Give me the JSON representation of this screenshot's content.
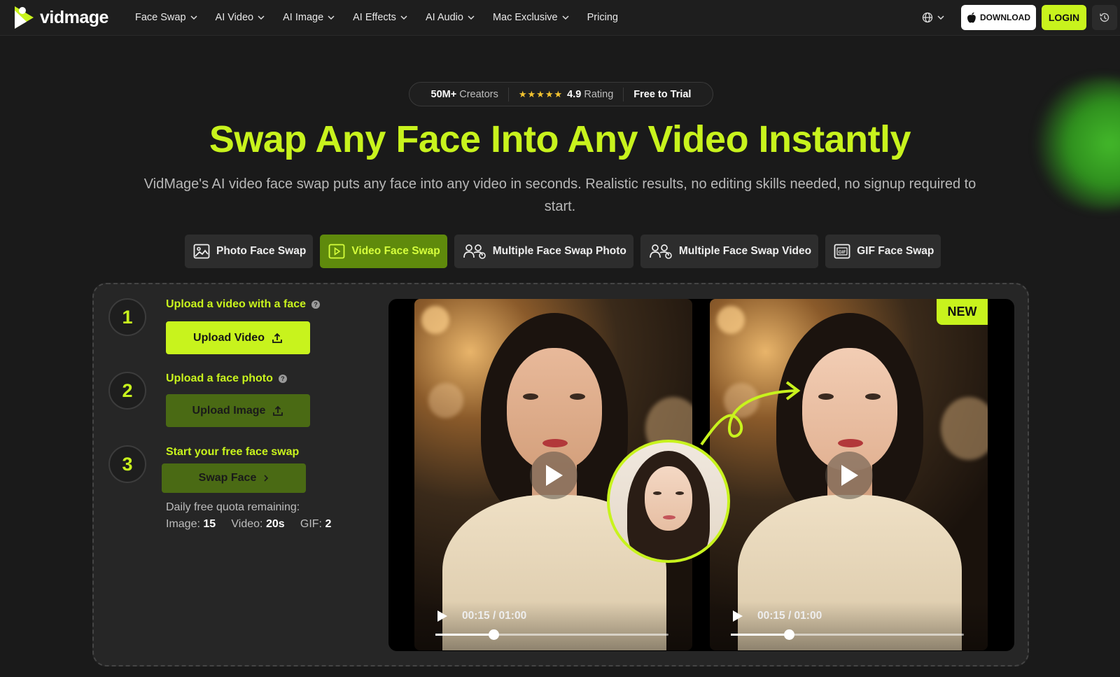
{
  "brand": {
    "name": "vidmage"
  },
  "nav": {
    "items": [
      {
        "label": "Face Swap",
        "dropdown": true
      },
      {
        "label": "AI Video",
        "dropdown": true
      },
      {
        "label": "AI Image",
        "dropdown": true
      },
      {
        "label": "AI Effects",
        "dropdown": true
      },
      {
        "label": "AI Audio",
        "dropdown": true
      },
      {
        "label": "Mac Exclusive",
        "dropdown": true
      },
      {
        "label": "Pricing",
        "dropdown": false
      }
    ],
    "download_label": "DOWNLOAD",
    "login_label": "LOGIN"
  },
  "stats": {
    "creators_value": "50M+",
    "creators_label": "Creators",
    "stars": "★★★★★",
    "rating_value": "4.9",
    "rating_label": "Rating",
    "trial_label": "Free to Trial"
  },
  "hero": {
    "title": "Swap Any Face Into Any Video Instantly",
    "subtitle": "VidMage's AI video face swap puts any face into any video in seconds. Realistic results, no editing skills needed, no signup required to start."
  },
  "tabs": [
    {
      "label": "Photo Face Swap",
      "icon": "image-icon",
      "active": false
    },
    {
      "label": "Video Face Swap",
      "icon": "video-icon",
      "active": true
    },
    {
      "label": "Multiple Face Swap Photo",
      "icon": "multi-user-icon",
      "active": false
    },
    {
      "label": "Multiple Face Swap Video",
      "icon": "multi-user-icon",
      "active": false
    },
    {
      "label": "GIF Face Swap",
      "icon": "gif-icon",
      "active": false
    }
  ],
  "steps": [
    {
      "number": "1",
      "title": "Upload a video with a face",
      "button": "Upload Video"
    },
    {
      "number": "2",
      "title": "Upload a face photo",
      "button": "Upload Image"
    },
    {
      "number": "3",
      "title": "Start your free face swap",
      "button": "Swap Face"
    }
  ],
  "quota": {
    "label": "Daily free quota remaining:",
    "image_label": "Image:",
    "image_value": "15",
    "video_label": "Video:",
    "video_value": "20s",
    "gif_label": "GIF:",
    "gif_value": "2"
  },
  "preview": {
    "badge": "NEW",
    "left_video": {
      "time": "00:15 / 01:00",
      "progress": 0.25
    },
    "right_video": {
      "time": "00:15 / 01:00",
      "progress": 0.25
    }
  },
  "colors": {
    "accent": "#c8f31d",
    "background": "#1a1a1a",
    "panel": "#262626",
    "active_tab": "#5f8a0c"
  }
}
